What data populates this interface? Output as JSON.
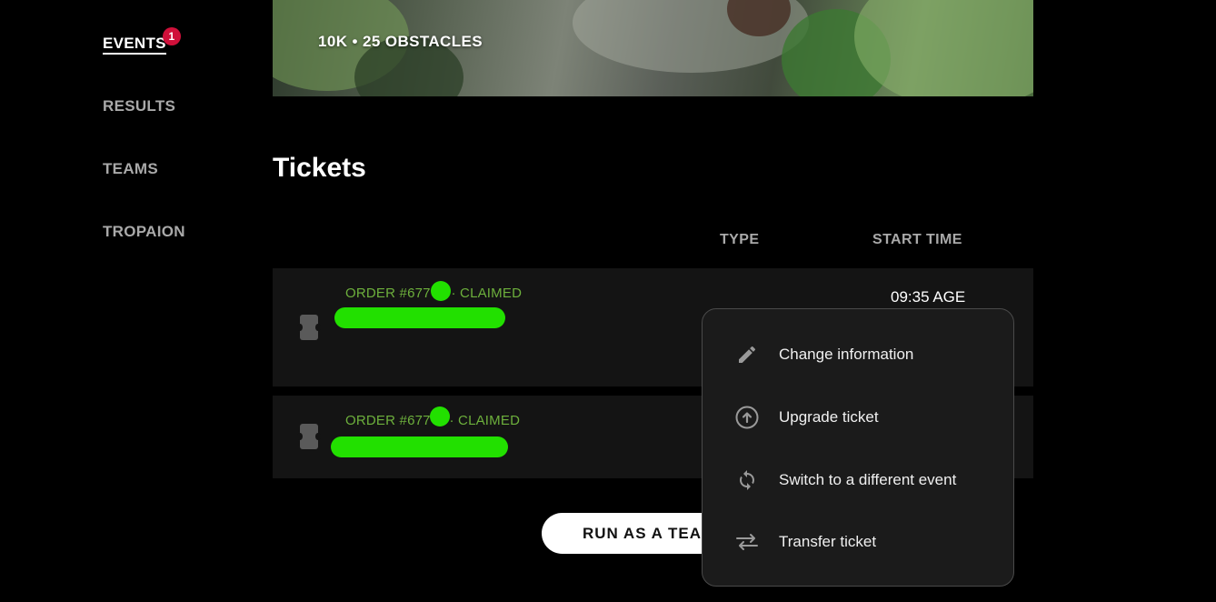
{
  "sidebar": {
    "items": [
      {
        "label": "EVENTS",
        "badge": "1"
      },
      {
        "label": "RESULTS"
      },
      {
        "label": "TEAMS"
      },
      {
        "label": "TROPAION"
      }
    ]
  },
  "hero": {
    "subtitle": "10K • 25 OBSTACLES"
  },
  "tickets_section": {
    "title": "Tickets",
    "columns": {
      "type": "TYPE",
      "start_time": "START TIME"
    },
    "rows": [
      {
        "order_prefix": "ORDER #677",
        "status": "· CLAIMED",
        "start_time": "09:35 AGE"
      },
      {
        "order_prefix": "ORDER #677",
        "status": "· CLAIMED"
      }
    ]
  },
  "team_button": {
    "label": "RUN AS A TEAM"
  },
  "context_menu": {
    "items": [
      {
        "label": "Change information",
        "icon": "pencil-icon"
      },
      {
        "label": "Upgrade ticket",
        "icon": "arrow-up-circle-icon"
      },
      {
        "label": "Switch to a different event",
        "icon": "sync-icon"
      },
      {
        "label": "Transfer ticket",
        "icon": "transfer-arrows-icon"
      }
    ]
  },
  "colors": {
    "background": "#000000",
    "accent_green": "#6db03c",
    "redaction_green": "#22e000",
    "badge_red": "#d0103a"
  }
}
